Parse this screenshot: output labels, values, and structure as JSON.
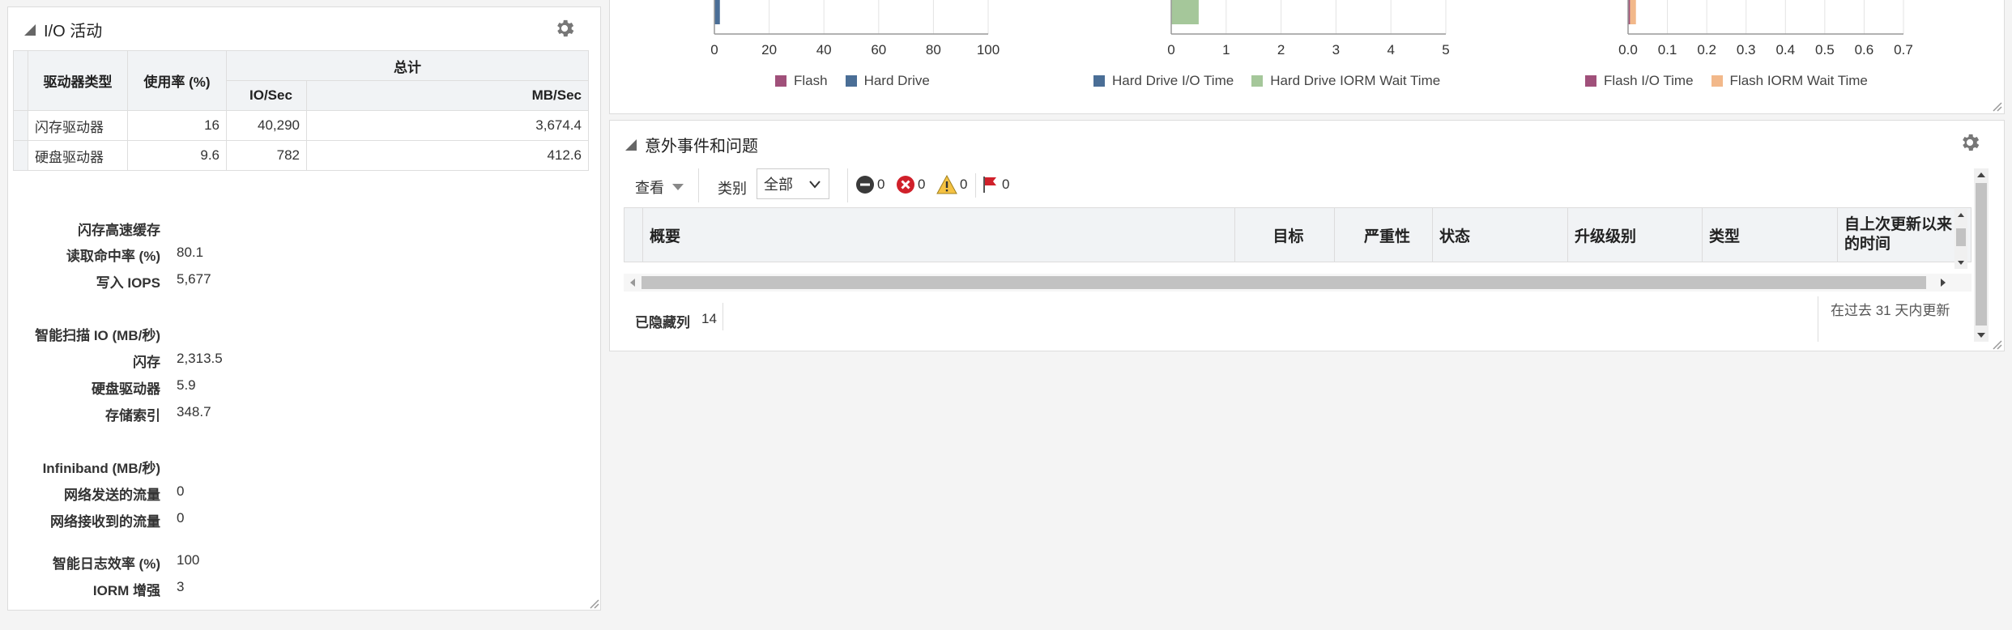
{
  "io_panel": {
    "title": "I/O 活动",
    "table": {
      "col_type": "驱动器类型",
      "col_usage": "使用率 (%)",
      "col_total": "总计",
      "col_io": "IO/Sec",
      "col_mb": "MB/Sec",
      "rows": [
        {
          "type": "闪存驱动器",
          "usage": "16",
          "io": "40,290",
          "mb": "3,674.4"
        },
        {
          "type": "硬盘驱动器",
          "usage": "9.6",
          "io": "782",
          "mb": "412.6"
        }
      ]
    },
    "flash_cache": {
      "heading": "闪存高速缓存",
      "read_hit_label": "读取命中率 (%)",
      "read_hit_value": "80.1",
      "write_iops_label": "写入 IOPS",
      "write_iops_value": "5,677"
    },
    "smart_scan": {
      "heading": "智能扫描 IO (MB/秒)",
      "flash_label": "闪存",
      "flash_value": "2,313.5",
      "disk_label": "硬盘驱动器",
      "disk_value": "5.9",
      "index_label": "存储索引",
      "index_value": "348.7"
    },
    "infiniband": {
      "heading": "Infiniband (MB/秒)",
      "sent_label": "网络发送的流量",
      "sent_value": "0",
      "recv_label": "网络接收到的流量",
      "recv_value": "0"
    },
    "smart_log_label": "智能日志效率 (%)",
    "smart_log_value": "100",
    "iorm_label": "IORM 增强",
    "iorm_value": "3"
  },
  "chart_data": [
    {
      "type": "bar",
      "x_ticks": [
        "0",
        "20",
        "40",
        "60",
        "80",
        "100"
      ],
      "xlim": [
        0,
        100
      ],
      "series": [
        {
          "name": "Flash",
          "color": "#a0507a",
          "value": 0
        },
        {
          "name": "Hard Drive",
          "color": "#4a6e96",
          "value": 2
        }
      ]
    },
    {
      "type": "bar",
      "x_ticks": [
        "0",
        "1",
        "2",
        "3",
        "4",
        "5"
      ],
      "xlim": [
        0,
        5
      ],
      "series": [
        {
          "name": "Hard Drive I/O Time",
          "color": "#4a6e96",
          "value": 0
        },
        {
          "name": "Hard Drive IORM Wait Time",
          "color": "#a5c79a",
          "value": 0.5
        }
      ]
    },
    {
      "type": "bar",
      "x_ticks": [
        "0.0",
        "0.1",
        "0.2",
        "0.3",
        "0.4",
        "0.5",
        "0.6",
        "0.7"
      ],
      "xlim": [
        0,
        0.7
      ],
      "series": [
        {
          "name": "Flash I/O Time",
          "color": "#a0507a",
          "value": 0.005
        },
        {
          "name": "Flash IORM Wait Time",
          "color": "#f2b88a",
          "value": 0.015
        }
      ]
    }
  ],
  "incidents_panel": {
    "title": "意外事件和问题",
    "toolbar": {
      "view_label": "查看",
      "category_label": "类别",
      "category_value": "全部",
      "count_critical": "0",
      "count_error": "0",
      "count_warning": "0",
      "count_flag": "0"
    },
    "columns": [
      "概要",
      "目标",
      "严重性",
      "状态",
      "升级级别",
      "类型",
      "自上次更新以来的时间"
    ],
    "hidden_columns_label": "已隐藏列",
    "hidden_columns_count": "14",
    "footer_note": "在过去 31 天内更新"
  }
}
